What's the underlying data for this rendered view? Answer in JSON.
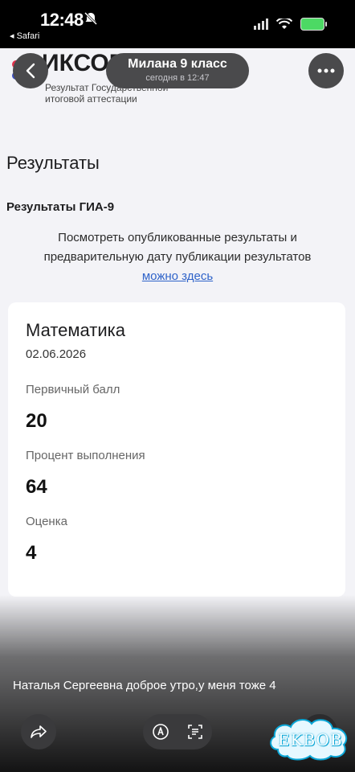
{
  "status_bar": {
    "time": "12:48",
    "back_app": "◂ Safari",
    "icons": [
      "bell-off-icon",
      "signal-icon",
      "wifi-icon",
      "battery-charging-icon"
    ],
    "battery_color": "#4cd964"
  },
  "viewer_header": {
    "title": "Милана 9 класс",
    "subtitle": "сегодня в 12:47"
  },
  "site": {
    "logo_text": "ИКСОР",
    "logo_desc": "Результат Государственной итоговой аттестации"
  },
  "page": {
    "section_title": "Результаты",
    "subhead": "Результаты ГИА-9",
    "info_text": "Посмотреть опубликованные результаты и предварительную дату публикации результатов",
    "info_link": "можно здесь"
  },
  "result_card": {
    "subject": "Математика",
    "date": "02.06.2026",
    "fields": [
      {
        "label": "Первичный балл",
        "value": "20"
      },
      {
        "label": "Процент выполнения",
        "value": "64"
      },
      {
        "label": "Оценка",
        "value": "4"
      }
    ]
  },
  "message": {
    "caption": "Наталья Сергеевна доброе утро,у меня тоже 4"
  },
  "watermark": {
    "text": "EKBOB"
  },
  "colors": {
    "link": "#2f63c9",
    "watermark_outline": "#0aa6d6"
  }
}
